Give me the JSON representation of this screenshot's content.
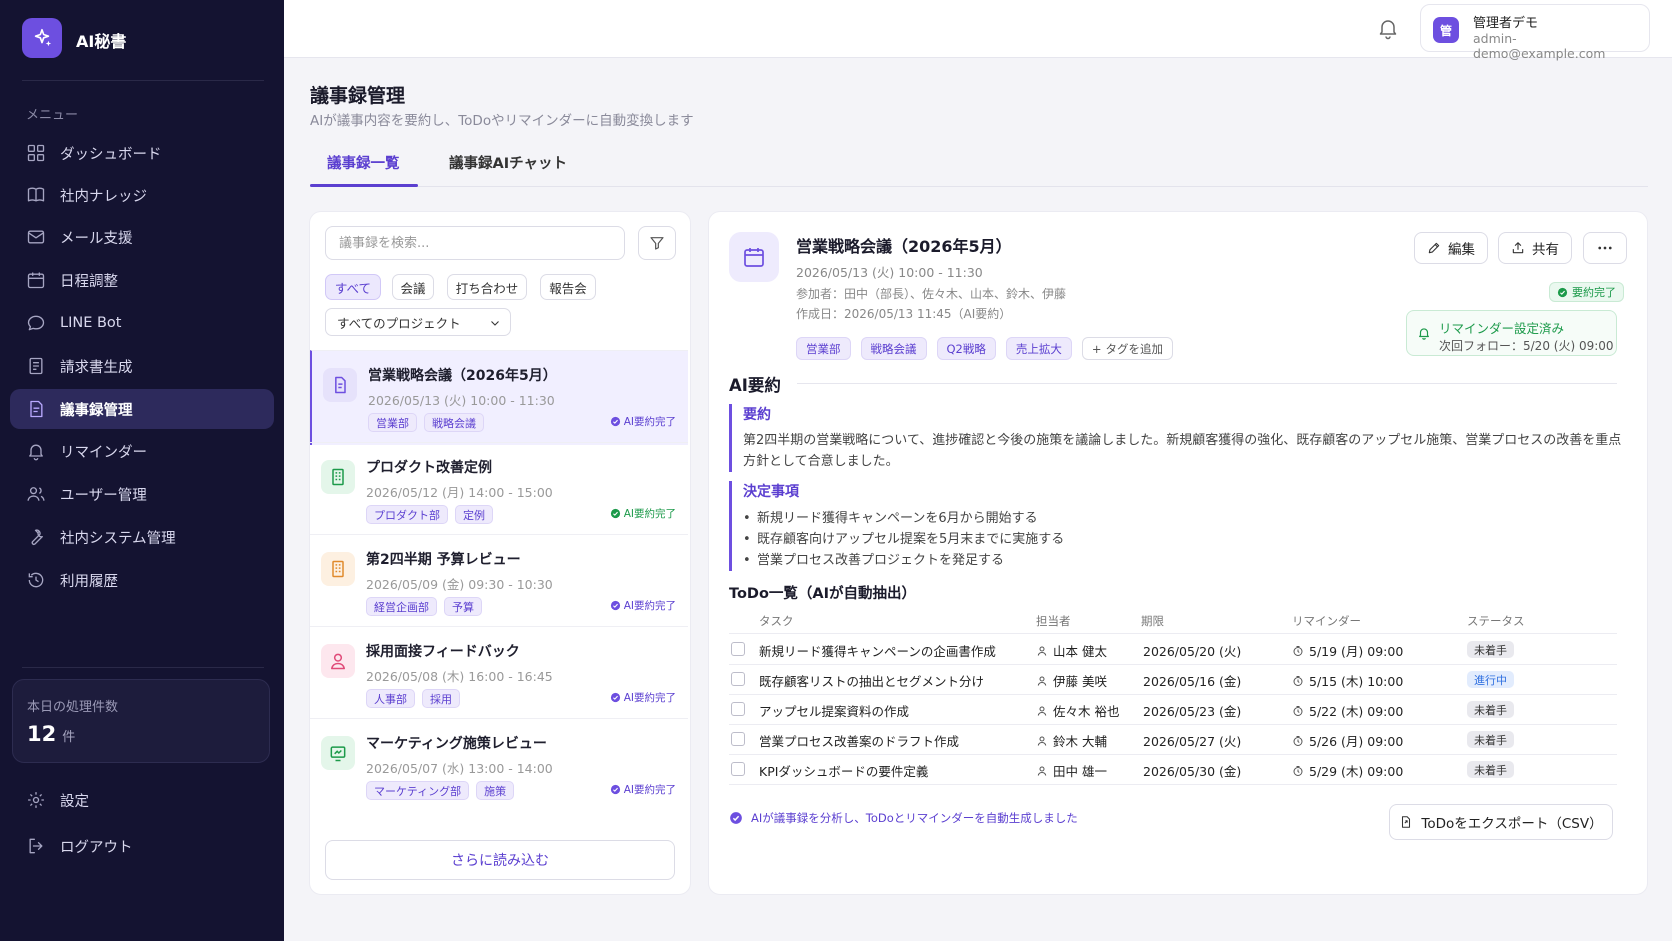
{
  "app": {
    "title": "AI秘書"
  },
  "sidebar": {
    "menu_label": "メニュー",
    "items": [
      {
        "label": "ダッシュボード",
        "icon": "grid-icon"
      },
      {
        "label": "社内ナレッジ",
        "icon": "book-icon"
      },
      {
        "label": "メール支援",
        "icon": "mail-icon"
      },
      {
        "label": "日程調整",
        "icon": "calendar-icon"
      },
      {
        "label": "LINE Bot",
        "icon": "chat-bubble-icon"
      },
      {
        "label": "請求書生成",
        "icon": "invoice-icon"
      },
      {
        "label": "議事録管理",
        "icon": "minutes-icon",
        "active": true
      },
      {
        "label": "リマインダー",
        "icon": "bell-icon"
      },
      {
        "label": "ユーザー管理",
        "icon": "users-icon"
      },
      {
        "label": "社内システム管理",
        "icon": "wrench-icon"
      },
      {
        "label": "利用履歴",
        "icon": "history-icon"
      }
    ],
    "stats": {
      "label": "本日の処理件数",
      "value": "12",
      "unit": "件"
    },
    "settings_label": "設定",
    "logout_label": "ログアウト"
  },
  "user": {
    "avatar": "管",
    "name": "管理者デモ",
    "email": "admin-demo@example.com"
  },
  "page": {
    "title": "議事録管理",
    "subtitle": "AIが議事内容を要約し、ToDoやリマインダーに自動変換します",
    "tabs": [
      "議事録一覧",
      "議事録AIチャット"
    ]
  },
  "list": {
    "search_placeholder": "議事録を検索...",
    "filters": [
      "すべて",
      "会議",
      "打ち合わせ",
      "報告会"
    ],
    "project_select": "すべてのプロジェクト",
    "status_label": "AI要約完了",
    "items": [
      {
        "title": "営業戦略会議（2026年5月）",
        "date": "2026/05/13 (火) 10:00 - 11:30",
        "tags": [
          "営業部",
          "戦略会議"
        ],
        "icon": "document-icon",
        "color": "#6d4fe0",
        "bg": "#e6e2fb"
      },
      {
        "title": "プロダクト改善定例",
        "date": "2026/05/12 (月) 14:00 - 15:00",
        "tags": [
          "プロダクト部",
          "定例"
        ],
        "icon": "building-icon",
        "color": "#1c9a4a",
        "bg": "#e4f6ea"
      },
      {
        "title": "第2四半期 予算レビュー",
        "date": "2026/05/09 (金) 09:30 - 10:30",
        "tags": [
          "経営企画部",
          "予算"
        ],
        "icon": "building-icon",
        "color": "#e08a2c",
        "bg": "#fdf0e1"
      },
      {
        "title": "採用面接フィードバック",
        "date": "2026/05/08 (木) 16:00 - 16:45",
        "tags": [
          "人事部",
          "採用"
        ],
        "icon": "person-icon",
        "color": "#e04a78",
        "bg": "#fde7ee"
      },
      {
        "title": "マーケティング施策レビュー",
        "date": "2026/05/07 (水) 13:00 - 14:00",
        "tags": [
          "マーケティング部",
          "施策"
        ],
        "icon": "chart-icon",
        "color": "#1c9a4a",
        "bg": "#e4f6ea"
      }
    ],
    "load_more": "さらに読み込む"
  },
  "detail": {
    "title": "営業戦略会議（2026年5月）",
    "date": "2026/05/13 (火) 10:00 - 11:30",
    "participants": "参加者：田中（部長）、佐々木、山本、鈴木、伊藤",
    "created": "作成日：2026/05/13 11:45（AI要約）",
    "tags": [
      "営業部",
      "戦略会議",
      "Q2戦略",
      "売上拡大"
    ],
    "add_tag": "タグを追加",
    "edit_label": "編集",
    "share_label": "共有",
    "badge": "要約完了",
    "reminder_title": "リマインダー設定済み",
    "reminder_sub": "次回フォロー：5/20 (火) 09:00",
    "ai_summary_title": "AI要約",
    "summary_head": "要約",
    "summary_text": "第2四半期の営業戦略について、進捗確認と今後の施策を議論しました。新規顧客獲得の強化、既存顧客のアップセル施策、営業プロセスの改善を重点方針として合意しました。",
    "decisions_head": "決定事項",
    "decisions": [
      "新規リード獲得キャンペーンを6月から開始する",
      "既存顧客向けアップセル提案を5月末までに実施する",
      "営業プロセス改善プロジェクトを発足する"
    ],
    "todo_title": "ToDo一覧（AIが自動抽出）",
    "todo_headers": [
      "タスク",
      "担当者",
      "期限",
      "リマインダー",
      "ステータス"
    ],
    "todos": [
      {
        "task": "新規リード獲得キャンペーンの企画書作成",
        "owner": "山本 健太",
        "due": "2026/05/20 (火)",
        "reminder": "5/19 (月) 09:00",
        "status": "未着手",
        "kind": "todo"
      },
      {
        "task": "既存顧客リストの抽出とセグメント分け",
        "owner": "伊藤 美咲",
        "due": "2026/05/16 (金)",
        "reminder": "5/15 (木) 10:00",
        "status": "進行中",
        "kind": "prog"
      },
      {
        "task": "アップセル提案資料の作成",
        "owner": "佐々木 裕也",
        "due": "2026/05/23 (金)",
        "reminder": "5/22 (木) 09:00",
        "status": "未着手",
        "kind": "todo"
      },
      {
        "task": "営業プロセス改善案のドラフト作成",
        "owner": "鈴木 大輔",
        "due": "2026/05/27 (火)",
        "reminder": "5/26 (月) 09:00",
        "status": "未着手",
        "kind": "todo"
      },
      {
        "task": "KPIダッシュボードの要件定義",
        "owner": "田中 雄一",
        "due": "2026/05/30 (金)",
        "reminder": "5/29 (木) 09:00",
        "status": "未着手",
        "kind": "todo"
      }
    ],
    "footnote": "AIが議事録を分析し、ToDoとリマインダーを自動生成しました",
    "export_label": "ToDoをエクスポート（CSV）"
  },
  "colors": {
    "accent": "#6d4fe0",
    "sidebar": "#141331",
    "success": "#1c9a4a"
  }
}
